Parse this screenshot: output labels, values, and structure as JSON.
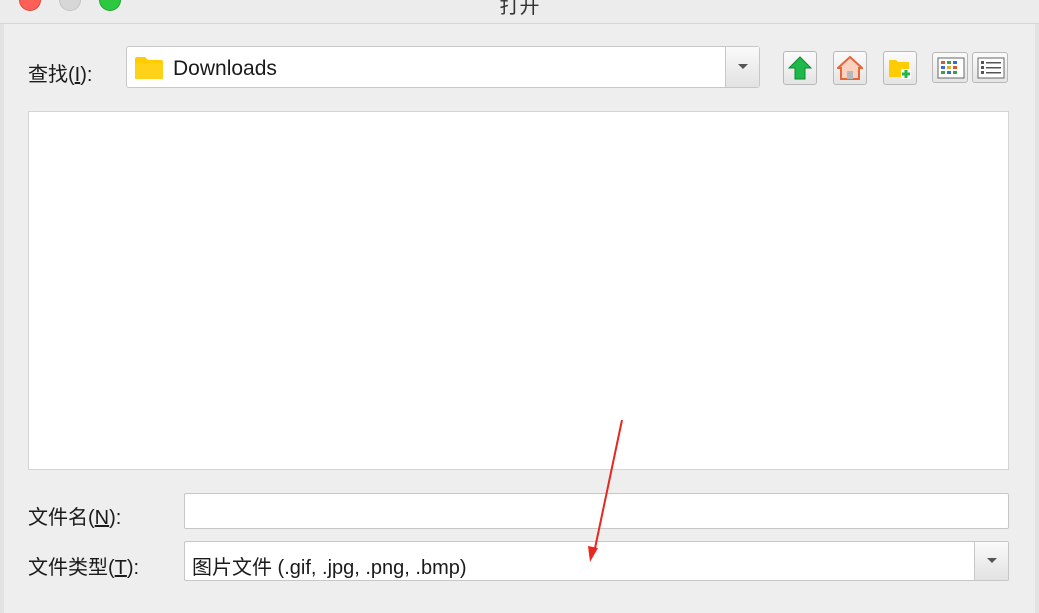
{
  "window": {
    "title": "打开"
  },
  "lookin": {
    "label_prefix": "查找(",
    "label_mnemonic": "I",
    "label_suffix": "):",
    "value": "Downloads"
  },
  "toolbar": {
    "up_icon": "up-one-level-icon",
    "home_icon": "home-icon",
    "new_folder_icon": "new-folder-icon",
    "list_view_icon": "list-view-icon",
    "details_view_icon": "details-view-icon"
  },
  "filename": {
    "label_prefix": "文件名(",
    "label_mnemonic": "N",
    "label_suffix": "):",
    "value": ""
  },
  "filetype": {
    "label_prefix": "文件类型(",
    "label_mnemonic": "T",
    "label_suffix": "):",
    "value": "图片文件 (.gif, .jpg, .png, .bmp)"
  },
  "colors": {
    "folder": "#ffcc00",
    "up_arrow": "#1fb84a",
    "home": "#f07a4a",
    "annotation_arrow": "#e8281e"
  }
}
